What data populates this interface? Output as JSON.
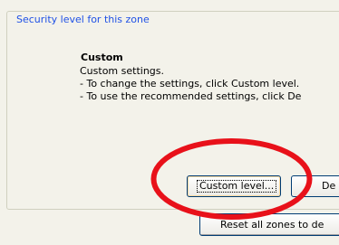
{
  "security": {
    "group_title": "Security level for this zone",
    "level_title": "Custom",
    "description_lines": [
      "Custom settings.",
      "- To change the settings, click Custom level.",
      "- To use the recommended settings, click De"
    ]
  },
  "buttons": {
    "custom_level": "Custom level...",
    "default_level": "De",
    "reset_all_zones": "Reset all zones to de"
  },
  "annotation": {
    "highlight_color": "#e8111a"
  }
}
